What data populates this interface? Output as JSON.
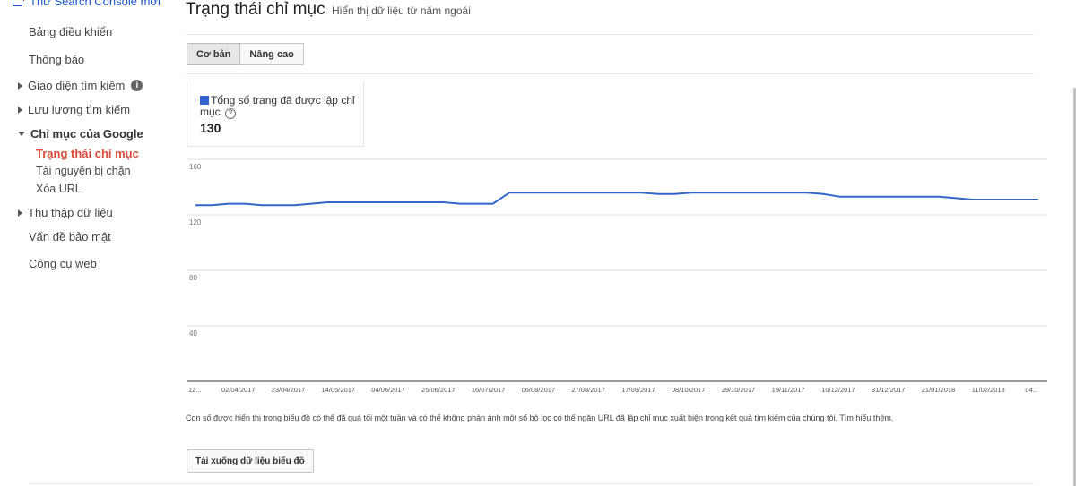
{
  "sidebar": {
    "top_link": "Thử Search Console mới",
    "items": [
      {
        "label": "Bảng điều khiển"
      },
      {
        "label": "Thông báo"
      },
      {
        "label": "Giao diện tìm kiếm"
      },
      {
        "label": "Lưu lượng tìm kiếm"
      },
      {
        "label": "Chỉ mục của Google"
      },
      {
        "label": "Trạng thái chỉ mục"
      },
      {
        "label": "Tài nguyên bị chặn"
      },
      {
        "label": "Xóa URL"
      },
      {
        "label": "Thu thập dữ liệu"
      },
      {
        "label": "Vấn đề bảo mật"
      },
      {
        "label": "Công cụ web"
      }
    ]
  },
  "header": {
    "title": "Trạng thái chỉ mục",
    "subtitle": "Hiển thị dữ liệu từ năm ngoái"
  },
  "tabs": [
    {
      "label": "Cơ bản",
      "active": true
    },
    {
      "label": "Nâng cao",
      "active": false
    }
  ],
  "summary": {
    "legend_label": "Tổng số trang đã được lập chỉ mục",
    "value": "130",
    "series_color": "#3366cc"
  },
  "chart_data": {
    "type": "line",
    "y_ticks": [
      "160",
      "120",
      "80",
      "40"
    ],
    "ylim": [
      0,
      160
    ],
    "x_tick_labels": [
      "12...",
      "02/04/2017",
      "23/04/2017",
      "14/05/2017",
      "04/06/2017",
      "25/06/2017",
      "16/07/2017",
      "06/08/2017",
      "27/08/2017",
      "17/09/2017",
      "08/10/2017",
      "29/10/2017",
      "19/11/2017",
      "10/12/2017",
      "31/12/2017",
      "21/01/2018",
      "11/02/2018",
      "04..."
    ],
    "series": [
      {
        "name": "Tổng số trang đã được lập chỉ mục",
        "x": [
          "12/03/2017",
          "19/03/2017",
          "26/03/2017",
          "02/04/2017",
          "09/04/2017",
          "16/04/2017",
          "23/04/2017",
          "30/04/2017",
          "07/05/2017",
          "14/05/2017",
          "21/05/2017",
          "28/05/2017",
          "04/06/2017",
          "11/06/2017",
          "18/06/2017",
          "25/06/2017",
          "02/07/2017",
          "09/07/2017",
          "16/07/2017",
          "23/07/2017",
          "30/07/2017",
          "06/08/2017",
          "13/08/2017",
          "20/08/2017",
          "27/08/2017",
          "03/09/2017",
          "10/09/2017",
          "17/09/2017",
          "24/09/2017",
          "01/10/2017",
          "08/10/2017",
          "15/10/2017",
          "22/10/2017",
          "29/10/2017",
          "05/11/2017",
          "12/11/2017",
          "19/11/2017",
          "26/11/2017",
          "03/12/2017",
          "10/12/2017",
          "17/12/2017",
          "24/12/2017",
          "31/12/2017",
          "07/01/2018",
          "14/01/2018",
          "21/01/2018",
          "28/01/2018",
          "04/02/2018",
          "11/02/2018",
          "18/02/2018",
          "25/02/2018",
          "04/03/2018"
        ],
        "values": [
          127,
          127,
          128,
          128,
          127,
          127,
          127,
          128,
          129,
          129,
          129,
          129,
          129,
          129,
          129,
          129,
          128,
          128,
          128,
          136,
          136,
          136,
          136,
          136,
          136,
          136,
          136,
          136,
          135,
          135,
          136,
          136,
          136,
          136,
          136,
          136,
          136,
          136,
          135,
          133,
          133,
          133,
          133,
          133,
          133,
          133,
          132,
          131,
          131,
          131,
          131,
          131
        ]
      }
    ]
  },
  "footer": {
    "note": "Con số được hiển thị trong biểu đồ có thể đã quá tối một tuần và có thể không phản ánh một số bộ lọc có thể ngăn URL đã lập chỉ mục xuất hiện trong kết quả tìm kiếm của chúng tôi.",
    "learn_more": "Tìm hiểu thêm.",
    "download_button": "Tải xuống dữ liệu biểu đồ"
  }
}
